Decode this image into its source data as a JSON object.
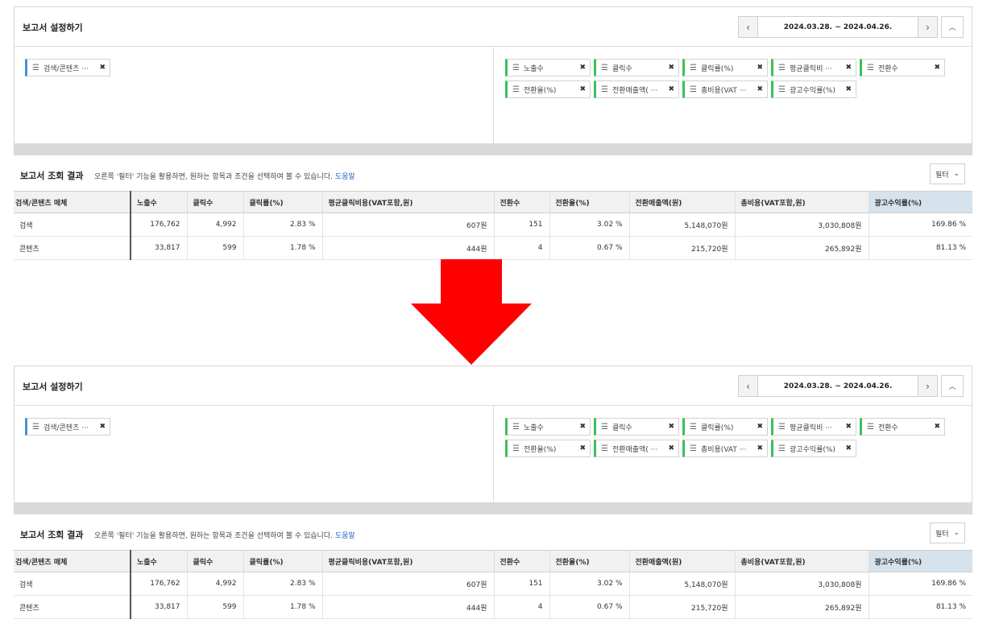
{
  "panels": [
    {
      "settings": {
        "title": "보고서 설정하기",
        "date_range": "2024.03.28. ~ 2024.04.26.",
        "prev_icon": "chevron-left-icon",
        "next_icon": "chevron-right-icon",
        "collapse_icon": "chevron-up-icon",
        "dimension_chips": [
          "검색/콘텐츠 ···"
        ],
        "metric_chips": [
          "노출수",
          "클릭수",
          "클릭률(%)",
          "평균클릭비 ···",
          "전환수",
          "전환율(%)",
          "전환매출액( ···",
          "총비용(VAT ···",
          "광고수익률(%)"
        ]
      },
      "results": {
        "title": "보고서 조회 결과",
        "description": "오른쪽 '필터' 기능을 활용하면, 원하는 항목과 조건을 선택하여 볼 수 있습니다.",
        "help_link": "도움말",
        "filter_label": "필터",
        "columns": [
          "검색/콘텐츠 매체",
          "노출수",
          "클릭수",
          "클릭률(%)",
          "평균클릭비용(VAT포함,원)",
          "전환수",
          "전환율(%)",
          "전환매출액(원)",
          "총비용(VAT포함,원)",
          "광고수익률(%)"
        ],
        "rows": [
          [
            "검색",
            "176,762",
            "4,992",
            "2.83 %",
            "607원",
            "151",
            "3.02 %",
            "5,148,070원",
            "3,030,808원",
            "169.86 %"
          ],
          [
            "콘텐츠",
            "33,817",
            "599",
            "1.78 %",
            "444원",
            "4",
            "0.67 %",
            "215,720원",
            "265,892원",
            "81.13 %"
          ]
        ]
      }
    },
    {
      "settings": {
        "title": "보고서 설정하기",
        "date_range": "2024.03.28. ~ 2024.04.26.",
        "prev_icon": "chevron-left-icon",
        "next_icon": "chevron-right-icon",
        "collapse_icon": "chevron-up-icon",
        "dimension_chips": [
          "검색/콘텐츠 ···"
        ],
        "metric_chips": [
          "노출수",
          "클릭수",
          "클릭률(%)",
          "평균클릭비 ···",
          "전환수",
          "전환율(%)",
          "전환매출액( ···",
          "총비용(VAT ···",
          "광고수익률(%)"
        ]
      },
      "results": {
        "title": "보고서 조회 결과",
        "description": "오른쪽 '필터' 기능을 활용하면, 원하는 항목과 조건을 선택하여 볼 수 있습니다.",
        "help_link": "도움말",
        "filter_label": "필터",
        "columns": [
          "검색/콘텐츠 매체",
          "노출수",
          "클릭수",
          "클릭률(%)",
          "평균클릭비용(VAT포함,원)",
          "전환수",
          "전환율(%)",
          "전환매출액(원)",
          "총비용(VAT포함,원)",
          "광고수익률(%)"
        ],
        "rows": [
          [
            "검색",
            "176,762",
            "4,992",
            "2.83 %",
            "607원",
            "151",
            "3.02 %",
            "5,148,070원",
            "3,030,808원",
            "169.86 %"
          ],
          [
            "콘텐츠",
            "33,817",
            "599",
            "1.78 %",
            "444원",
            "4",
            "0.67 %",
            "215,720원",
            "265,892원",
            "81.13 %"
          ]
        ]
      }
    }
  ],
  "arrow": {
    "icon": "down-arrow-icon",
    "color": "#ff0000"
  },
  "colors": {
    "dimension_accent": "#4a90d9",
    "metric_accent": "#3cc05a",
    "highlight_header": "#d6e2ec",
    "link": "#2a62c9"
  }
}
